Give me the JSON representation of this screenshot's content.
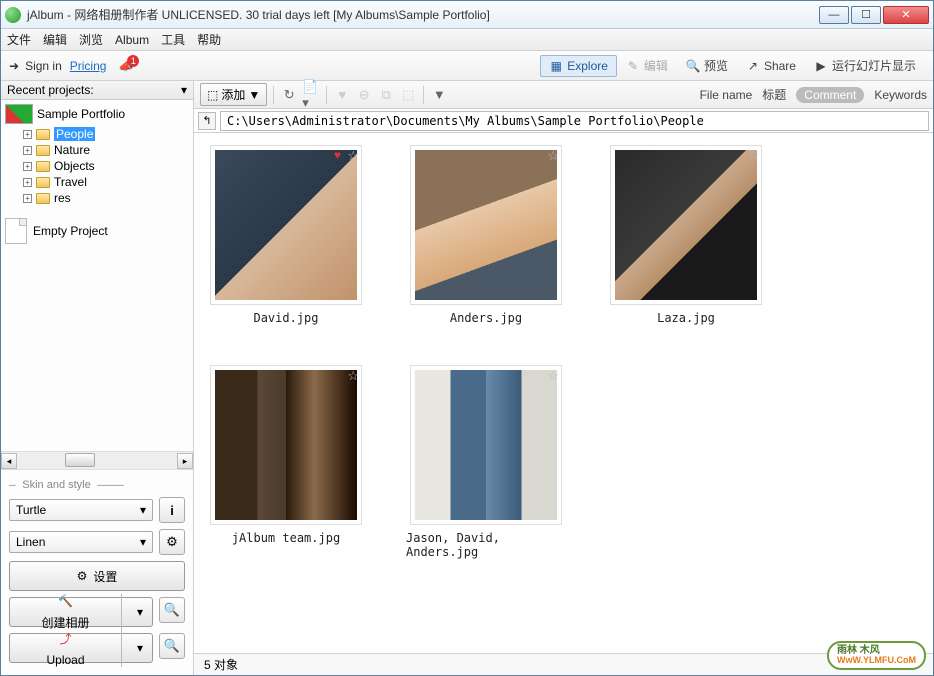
{
  "window": {
    "title": "jAlbum - 网络相册制作者 UNLICENSED. 30 trial days left [My Albums\\Sample Portfolio]"
  },
  "menu": [
    "文件",
    "编辑",
    "浏览",
    "Album",
    "工具",
    "帮助"
  ],
  "topbar": {
    "sign_in": "Sign in",
    "pricing": "Pricing",
    "notif_count": "1",
    "explore": "Explore",
    "edit": "编辑",
    "preview": "预览",
    "share": "Share",
    "slideshow": "运行幻灯片显示"
  },
  "sidebar": {
    "recent_label": "Recent projects:",
    "root": "Sample Portfolio",
    "items": [
      "People",
      "Nature",
      "Objects",
      "Travel",
      "res"
    ],
    "empty_project": "Empty Project",
    "skin_label": "Skin and style",
    "theme": "Turtle",
    "style": "Linen",
    "settings": "设置",
    "create": "创建相册",
    "upload": "Upload"
  },
  "toolbar": {
    "add": "添加"
  },
  "fields": {
    "filename": "File name",
    "title": "标题",
    "comment": "Comment",
    "keywords": "Keywords"
  },
  "path": "C:\\Users\\Administrator\\Documents\\My Albums\\Sample Portfolio\\People",
  "thumbs": [
    {
      "name": "David.jpg",
      "cls": "p1",
      "heart": true
    },
    {
      "name": "Anders.jpg",
      "cls": "p2",
      "heart": false
    },
    {
      "name": "Laza.jpg",
      "cls": "p3",
      "heart": false
    },
    {
      "name": "jAlbum team.jpg",
      "cls": "p4",
      "heart": false
    },
    {
      "name": "Jason, David, Anders.jpg",
      "cls": "p5",
      "heart": false
    }
  ],
  "status": "5 对象",
  "watermark": {
    "line1": "雨林 木风",
    "line2": "WwW.YLMFU.CoM"
  }
}
